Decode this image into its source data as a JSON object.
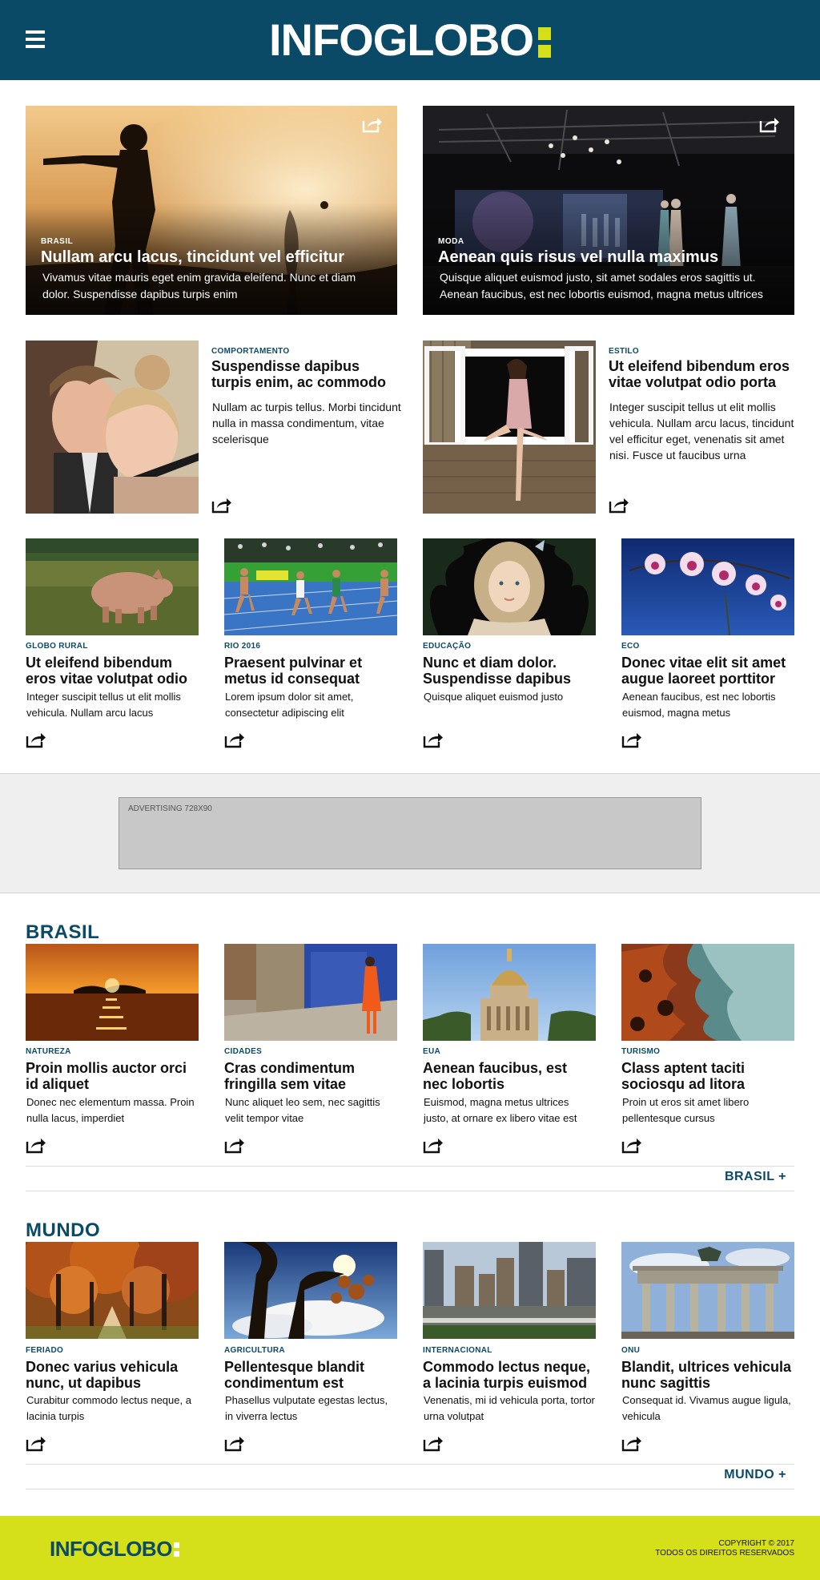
{
  "header": {
    "logo": "INFOGLOBO",
    "menu_icon": "hamburger-menu-icon",
    "bg": "#0b4a66",
    "accent": "#d6e01a"
  },
  "featured": [
    {
      "category": "BRASIL",
      "title": "Nullam arcu lacus, tincidunt vel efficitur",
      "text": "Vivamus vitae mauris eget enim gravida eleifend. Nunc et diam dolor. Suspendisse dapibus turpis enim"
    },
    {
      "category": "MODA",
      "title": "Aenean quis risus vel nulla maximus",
      "text": "Quisque aliquet euismod justo, sit amet sodales eros sagittis ut. Aenean faucibus, est nec lobortis euismod, magna metus ultrices"
    }
  ],
  "medium": [
    {
      "category": "COMPORTAMENTO",
      "title": "Suspendisse dapibus turpis enim, ac commodo",
      "text": "Nullam ac turpis tellus. Morbi tincidunt nulla in massa condimentum, vitae scelerisque"
    },
    {
      "category": "ESTILO",
      "title": "Ut eleifend bibendum eros vitae volutpat odio porta",
      "text": "Integer suscipit tellus ut elit mollis vehicula. Nullam arcu lacus, tincidunt vel efficitur eget, venenatis sit amet nisi. Fusce ut faucibus urna"
    }
  ],
  "top_small": [
    {
      "category": "GLOBO RURAL",
      "title": "Ut eleifend bibendum eros vitae volutpat odio",
      "text": "Integer suscipit tellus ut elit mollis vehicula. Nullam arcu lacus"
    },
    {
      "category": "RIO 2016",
      "title": "Praesent pulvinar et metus id consequat",
      "text": "Lorem ipsum dolor sit amet, consectetur adipiscing elit"
    },
    {
      "category": "EDUCAÇÃO",
      "title": "Nunc et diam dolor. Suspendisse dapibus",
      "text": "Quisque aliquet euismod justo"
    },
    {
      "category": "ECO",
      "title": "Donec vitae elit sit amet augue laoreet porttitor",
      "text": "Aenean faucibus, est nec lobortis euismod, magna metus"
    }
  ],
  "ad": {
    "label": "ADVERTISING 728X90"
  },
  "brasil": {
    "title": "BRASIL",
    "more": "BRASIL +",
    "items": [
      {
        "category": "NATUREZA",
        "title": "Proin mollis auctor orci id aliquet",
        "text": "Donec nec elementum massa. Proin nulla lacus, imperdiet"
      },
      {
        "category": "CIDADES",
        "title": "Cras condimentum fringilla sem vitae",
        "text": "Nunc aliquet leo sem, nec sagittis velit tempor vitae"
      },
      {
        "category": "EUA",
        "title": "Aenean faucibus, est nec lobortis",
        "text": "Euismod, magna metus ultrices justo, at ornare ex libero vitae est"
      },
      {
        "category": "TURISMO",
        "title": "Class aptent taciti sociosqu ad litora",
        "text": "Proin ut eros sit amet libero pellentesque cursus"
      }
    ]
  },
  "mundo": {
    "title": "MUNDO",
    "more": "MUNDO +",
    "items": [
      {
        "category": "FERIADO",
        "title": "Donec varius vehicula nunc, ut dapibus",
        "text": "Curabitur commodo lectus neque, a lacinia turpis"
      },
      {
        "category": "AGRICULTURA",
        "title": "Pellentesque blandit condimentum est",
        "text": "Phasellus vulputate egestas lectus, in viverra lectus"
      },
      {
        "category": "INTERNACIONAL",
        "title": "Commodo lectus neque, a lacinia turpis euismod",
        "text": "Venenatis, mi id vehicula porta, tortor urna volutpat"
      },
      {
        "category": "ONU",
        "title": "Blandit, ultrices vehicula nunc sagittis",
        "text": "Consequat id. Vivamus augue ligula, vehicula"
      }
    ]
  },
  "footer": {
    "logo": "INFOGLOBO",
    "copyright": "COPYRIGHT © 2017",
    "rights": "TODOS OS DIREITOS RESERVADOS"
  }
}
